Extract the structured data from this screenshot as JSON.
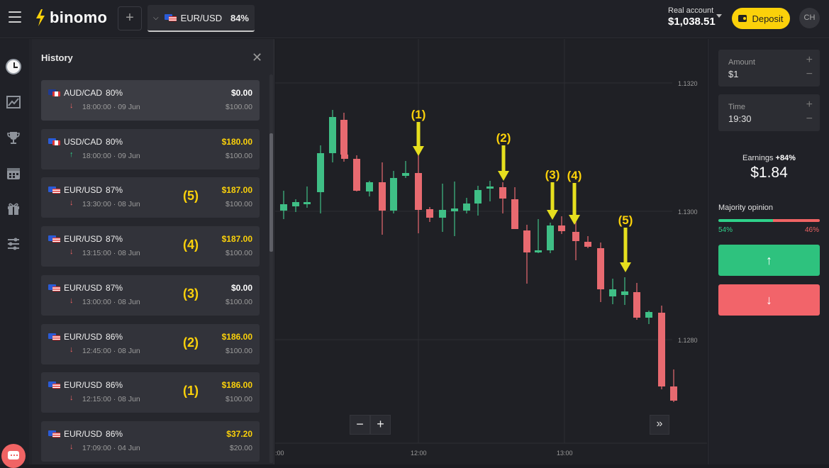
{
  "header": {
    "logo_text": "binomo",
    "add_label": "+",
    "asset_tab": {
      "name": "EUR/USD",
      "percent": "84%"
    },
    "account": {
      "label": "Real account",
      "balance": "$1,038.51"
    },
    "deposit_label": "Deposit",
    "avatar_initials": "CH"
  },
  "history": {
    "title": "History",
    "items": [
      {
        "asset": "AUD/CAD",
        "pct": "80%",
        "flag": "au",
        "direction": "down",
        "time": "18:00:00",
        "date": "09 Jun",
        "result": "$0.00",
        "stake": "$100.00",
        "marker": ""
      },
      {
        "asset": "USD/CAD",
        "pct": "80%",
        "flag": "ca",
        "direction": "up",
        "time": "18:00:00",
        "date": "09 Jun",
        "result": "$180.00",
        "stake": "$100.00",
        "marker": ""
      },
      {
        "asset": "EUR/USD",
        "pct": "87%",
        "flag": "eu",
        "direction": "down",
        "time": "13:30:00",
        "date": "08 Jun",
        "result": "$187.00",
        "stake": "$100.00",
        "marker": "(5)"
      },
      {
        "asset": "EUR/USD",
        "pct": "87%",
        "flag": "eu",
        "direction": "down",
        "time": "13:15:00",
        "date": "08 Jun",
        "result": "$187.00",
        "stake": "$100.00",
        "marker": "(4)"
      },
      {
        "asset": "EUR/USD",
        "pct": "87%",
        "flag": "eu",
        "direction": "down",
        "time": "13:00:00",
        "date": "08 Jun",
        "result": "$0.00",
        "stake": "$100.00",
        "marker": "(3)"
      },
      {
        "asset": "EUR/USD",
        "pct": "86%",
        "flag": "eu",
        "direction": "down",
        "time": "12:45:00",
        "date": "08 Jun",
        "result": "$186.00",
        "stake": "$100.00",
        "marker": "(2)"
      },
      {
        "asset": "EUR/USD",
        "pct": "86%",
        "flag": "eu",
        "direction": "down",
        "time": "12:15:00",
        "date": "08 Jun",
        "result": "$186.00",
        "stake": "$100.00",
        "marker": "(1)"
      },
      {
        "asset": "EUR/USD",
        "pct": "86%",
        "flag": "eu",
        "direction": "down",
        "time": "17:09:00",
        "date": "04 Jun",
        "result": "$37.20",
        "stake": "$20.00",
        "marker": ""
      }
    ]
  },
  "chart": {
    "price_labels": [
      "1.1320",
      "1.1300",
      "1.1280"
    ],
    "time_labels": [
      ":00",
      "12:00",
      "13:00"
    ],
    "annotations": [
      "(1)",
      "(2)",
      "(3)",
      "(4)",
      "(5)"
    ],
    "zoom_out": "−",
    "zoom_in": "+",
    "forward": "»",
    "colors": {
      "up": "#3fbf86",
      "down": "#e86a70",
      "arrow": "#e6df1e",
      "marker_text": "#fbd10a"
    }
  },
  "panel": {
    "amount": {
      "label": "Amount",
      "value": "$1"
    },
    "time": {
      "label": "Time",
      "value": "19:30"
    },
    "earnings_label": "Earnings",
    "earnings_pct": "+84%",
    "earnings_value": "$1.84",
    "majority_label": "Majority opinion",
    "majority_up": "54%",
    "majority_down": "46%",
    "majority_up_fraction": 0.54,
    "up_button": "↑",
    "down_button": "↓"
  }
}
